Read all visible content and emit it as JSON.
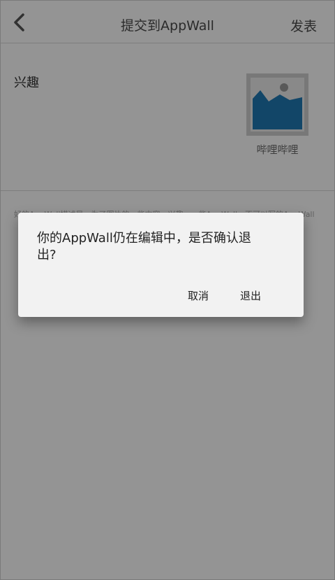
{
  "header": {
    "title": "提交到AppWall",
    "publish_label": "发表",
    "back_icon": "chevron-left-icon"
  },
  "app": {
    "category": "兴趣",
    "name": "哔哩哔哩",
    "thumbnail_icon": "image-placeholder-icon"
  },
  "description_hint": "好的AppWall描述是，为了图片的一些内容，兴趣，一些AppWall，不可以写的AppWall",
  "dialog": {
    "message": "你的AppWall仍在编辑中，是否确认退出?",
    "cancel_label": "取消",
    "exit_label": "退出"
  },
  "colors": {
    "overlay": "#000000",
    "dialog_bg": "#f2f2f2",
    "thumb_sky": "#d9d9d9",
    "thumb_mountain": "#1f79b4"
  }
}
